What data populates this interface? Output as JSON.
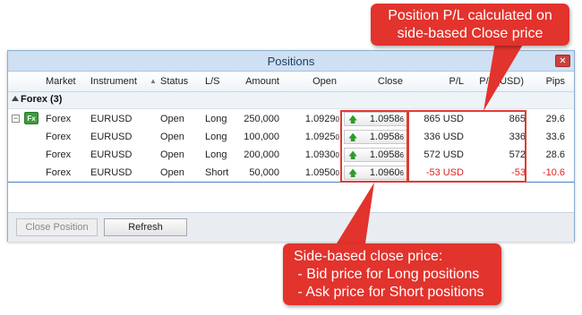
{
  "window": {
    "title": "Positions"
  },
  "columns": {
    "market": "Market",
    "instrument": "Instrument",
    "status": "Status",
    "ls": "L/S",
    "amount": "Amount",
    "open": "Open",
    "close": "Close",
    "pl": "P/L",
    "pl_usd": "P/L (USD)",
    "pips": "Pips"
  },
  "group": {
    "label": "Forex (3)"
  },
  "fx_icon_text": "Fx",
  "expander_symbol": "−",
  "rows": [
    {
      "market": "Forex",
      "instrument": "EURUSD",
      "status": "Open",
      "ls": "Long",
      "amount": "250,000",
      "open": "1.0929",
      "open_pip": "0",
      "close": "1.0958",
      "close_pip": "6",
      "pl": "865 USD",
      "pl_usd": "865",
      "pips": "29.6",
      "negative": false
    },
    {
      "market": "Forex",
      "instrument": "EURUSD",
      "status": "Open",
      "ls": "Long",
      "amount": "100,000",
      "open": "1.0925",
      "open_pip": "0",
      "close": "1.0958",
      "close_pip": "6",
      "pl": "336 USD",
      "pl_usd": "336",
      "pips": "33.6",
      "negative": false
    },
    {
      "market": "Forex",
      "instrument": "EURUSD",
      "status": "Open",
      "ls": "Long",
      "amount": "200,000",
      "open": "1.0930",
      "open_pip": "0",
      "close": "1.0958",
      "close_pip": "6",
      "pl": "572 USD",
      "pl_usd": "572",
      "pips": "28.6",
      "negative": false
    },
    {
      "market": "Forex",
      "instrument": "EURUSD",
      "status": "Open",
      "ls": "Short",
      "amount": "50,000",
      "open": "1.0950",
      "open_pip": "0",
      "close": "1.0960",
      "close_pip": "6",
      "pl": "-53 USD",
      "pl_usd": "-53",
      "pips": "-10.6",
      "negative": true
    }
  ],
  "buttons": {
    "close_position": "Close Position",
    "refresh": "Refresh"
  },
  "callouts": {
    "top_line1": "Position P/L calculated on",
    "top_line2": "side-based Close price",
    "bottom_line1": "Side-based close price:",
    "bottom_line2": " - Bid price for Long positions",
    "bottom_line3": " - Ask price for Short positions"
  },
  "icons": {
    "close": "close-icon",
    "sort": "sort-ascending-icon",
    "up_arrow": "up-arrow-icon",
    "fx": "fx-market-icon"
  },
  "colors": {
    "callout": "#e2332d",
    "negative": "#e02020",
    "up_arrow": "#2f9a2f",
    "fx_icon": "#3c9c3c"
  }
}
